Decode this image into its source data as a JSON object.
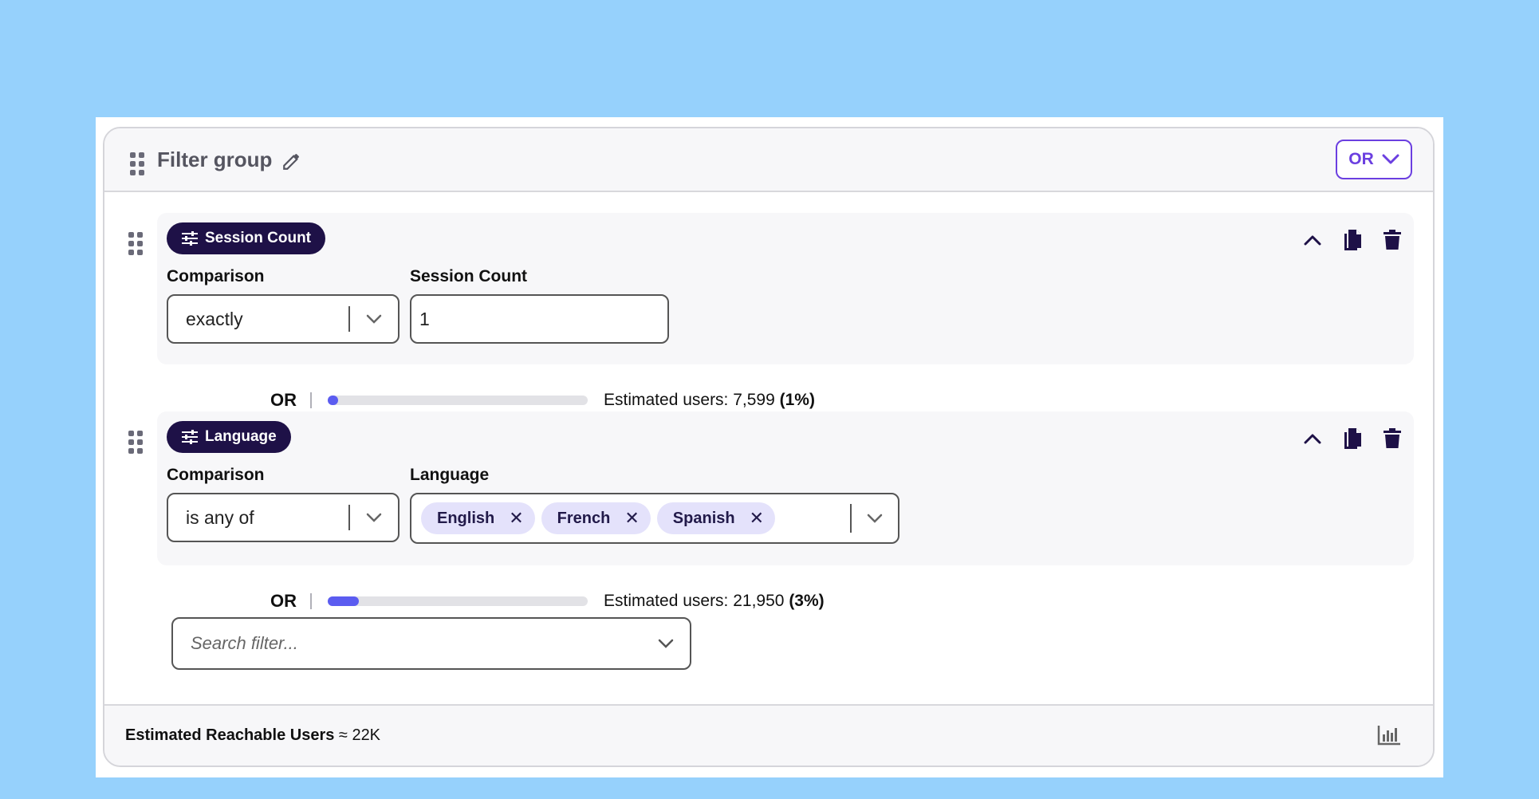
{
  "group": {
    "title": "Filter group",
    "operator": "OR"
  },
  "filters": [
    {
      "pill": "Session Count",
      "comparison_label": "Comparison",
      "comparison_value": "exactly",
      "value_label": "Session Count",
      "value": "1",
      "joiner": "OR",
      "estimated_text": "Estimated users: 7,599",
      "estimated_pct": "(1%)",
      "progress_fraction": 0.01
    },
    {
      "pill": "Language",
      "comparison_label": "Comparison",
      "comparison_value": "is any of",
      "value_label": "Language",
      "chips": [
        "English",
        "French",
        "Spanish"
      ],
      "joiner": "OR",
      "estimated_text": "Estimated users: 21,950",
      "estimated_pct": "(3%)",
      "progress_fraction": 0.03
    }
  ],
  "search": {
    "placeholder": "Search filter..."
  },
  "footer": {
    "label": "Estimated Reachable Users",
    "value": "≈ 22K"
  },
  "colors": {
    "background": "#96d1fc",
    "accent": "#6b3fe0",
    "pill": "#1e1147",
    "chip": "#e4e2fb",
    "progress": "#5b5cf0"
  }
}
